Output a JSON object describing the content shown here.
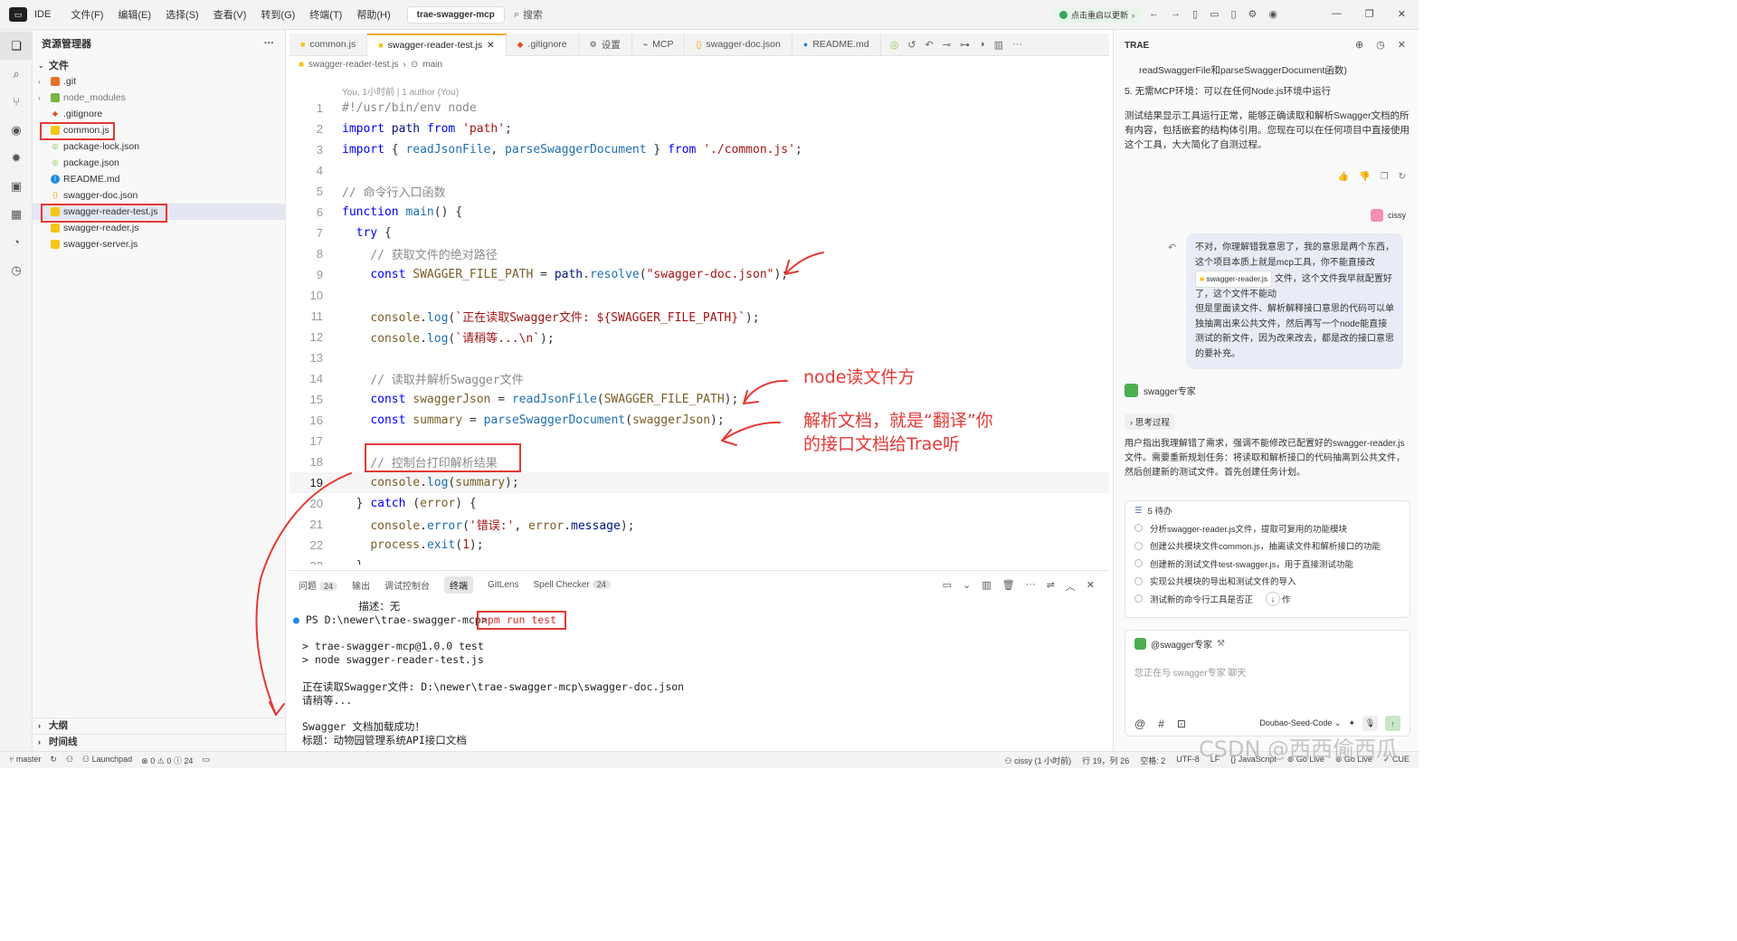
{
  "titlebar": {
    "ide_label": "IDE",
    "menu": [
      "文件(F)",
      "编辑(E)",
      "选择(S)",
      "查看(V)",
      "转到(G)",
      "终端(T)",
      "帮助(H)"
    ],
    "project": "trae-swagger-mcp",
    "search": "搜索",
    "restart": "点击重启以更新"
  },
  "explorer": {
    "title": "资源管理器",
    "section": "文件",
    "files": [
      ".git",
      "node_modules",
      ".gitignore",
      "common.js",
      "package-lock.json",
      "package.json",
      "README.md",
      "swagger-doc.json",
      "swagger-reader-test.js",
      "swagger-reader.js",
      "swagger-server.js"
    ],
    "outline": "大纲",
    "timeline": "时间线"
  },
  "tabs": [
    "common.js",
    "swagger-reader-test.js",
    ".gitignore",
    "设置",
    "MCP",
    "swagger-doc.json",
    "README.md"
  ],
  "breadcrumb": {
    "file": "swagger-reader-test.js",
    "symbol": "main"
  },
  "blame": "You, 1小时前 | 1 author (You)",
  "code": {
    "l1": "#!/usr/bin/env node",
    "l5": "// 命令行入口函数",
    "l8": "// 获取文件的绝对路径",
    "l14": "// 读取并解析Swagger文件",
    "l18": "// 控制台打印解析结果",
    "path_lit": "'path'",
    "common_lit": "'./common.js'",
    "doc_lit": "\"swagger-doc.json\"",
    "log1": "`正在读取Swagger文件: ${SWAGGER_FILE_PATH}`",
    "log2": "`请稍等...\\n`",
    "err_lit": "'错误:'"
  },
  "annotations": {
    "a1": "node读文件方",
    "a2": "解析文档，就是“翻译”你",
    "a3": "的接口文档给Trae听"
  },
  "panel": {
    "tabs": [
      "问题",
      "输出",
      "调试控制台",
      "终端",
      "GitLens",
      "Spell Checker"
    ],
    "problems_count": "24",
    "spell_count": "24",
    "terminal": [
      "         描述：无",
      "PS D:\\newer\\trae-swagger-mcp>",
      "npm run test",
      "> trae-swagger-mcp@1.0.0 test",
      "> node swagger-reader-test.js",
      "正在读取Swagger文件: D:\\newer\\trae-swagger-mcp\\swagger-doc.json",
      "请稍等...",
      "Swagger 文档加载成功！",
      "标题：动物园管理系统API接口文档"
    ]
  },
  "rpanel": {
    "title": "TRAE",
    "p0": "readSwaggerFile和parseSwaggerDocument函数)",
    "p1": "5. 无需MCP环境：可以在任何Node.js环境中运行",
    "p2": "测试结果显示工具运行正常，能够正确读取和解析Swagger文档的所有内容，包括嵌套的结构体引用。您现在可以在任何项目中直接使用这个工具，大大简化了自测过程。",
    "user": "cissy",
    "bubble_a": "不对，你理解错我意思了，我的意思是两个东西，这个项目本质上就是mcp工具，你不能直接改",
    "bubble_chip": "swagger-reader.js",
    "bubble_b": "文件，这个文件我早就配置好了，这个文件不能动",
    "bubble_c": "但是里面读文件、解析解释接口意思的代码可以单独抽离出来公共文件，然后再写一个node能直接测试的新文件，因为改来改去，都是改的接口意思的要补充。",
    "agent": "swagger专家",
    "thinking": "思考过程",
    "p3": "用户指出我理解错了需求，强调不能修改已配置好的swagger-reader.js文件。需要重新规划任务：将读取和解析接口的代码抽离到公共文件，然后创建新的测试文件。首先创建任务计划。",
    "todo_head": "5 待办",
    "todos": [
      "分析swagger-reader.js文件，提取可复用的功能模块",
      "创建公共模块文件common.js，抽离读文件和解析接口的功能",
      "创建新的测试文件test-swagger.js，用于直接测试功能",
      "实现公共模块的导出和测试文件的导入",
      "测试新的命令行工具是否正"
    ],
    "todo_tail": "作",
    "chat_agent": "@swagger专家",
    "chat_placeholder": "您正在与 swagger专家 聊天",
    "model": "Doubao-Seed-Code"
  },
  "status": {
    "branch": "master",
    "launchpad": "Launchpad",
    "errors": "0",
    "warnings": "0",
    "info": "24",
    "blame": "cissy (1 小时前)",
    "pos": "行 19，列 26",
    "spaces": "空格: 2",
    "enc": "UTF-8",
    "eol": "LF",
    "lang": "JavaScript",
    "golive": "Go Live",
    "golive2": "Go Live",
    "cue": "CUE"
  },
  "watermark": "CSDN @西西偷西瓜"
}
